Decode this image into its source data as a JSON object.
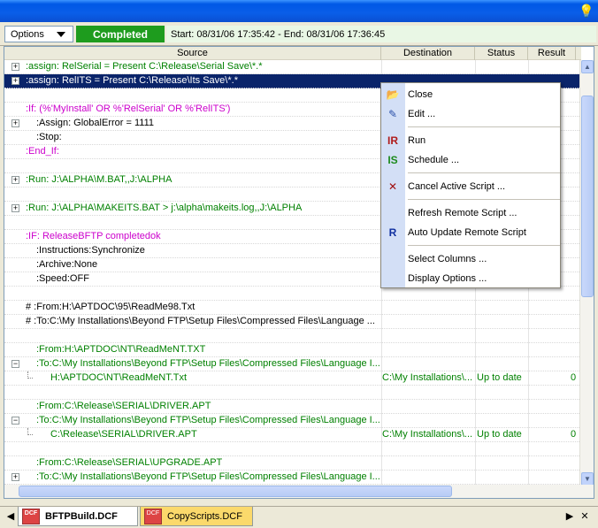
{
  "toolbar": {
    "options_label": "Options",
    "status": "Completed",
    "times": "Start: 08/31/06 17:35:42 - End: 08/31/06 17:36:45",
    "status_color": "#1e9c1e"
  },
  "columns": [
    "Source",
    "Destination",
    "Status",
    "Result"
  ],
  "rows": [
    {
      "src": ":assign: RelSerial = Present  C:\\Release\\Serial Save\\*.*",
      "color": "green",
      "exp": "+",
      "indent": 0
    },
    {
      "src": ":assign: RelITS    = Present  C:\\Release\\Its Save\\*.*",
      "color": "green",
      "exp": "+",
      "indent": 0,
      "selected": true
    },
    {
      "src": "",
      "indent": 0
    },
    {
      "src": ":If: (%'MyInstall' OR %'RelSerial' OR %'RelITS')",
      "color": "pink",
      "indent": 0
    },
    {
      "src": ":Assign: GlobalError = 1111",
      "color": "blk",
      "exp": "+",
      "indent": 1
    },
    {
      "src": ":Stop:",
      "color": "blk",
      "indent": 1
    },
    {
      "src": ":End_If:",
      "color": "pink",
      "indent": 0
    },
    {
      "src": "",
      "indent": 0
    },
    {
      "src": ":Run: J:\\ALPHA\\M.BAT,,J:\\ALPHA",
      "color": "green",
      "exp": "+",
      "indent": 0
    },
    {
      "src": "",
      "indent": 0
    },
    {
      "src": ":Run: J:\\ALPHA\\MAKEITS.BAT > j:\\alpha\\makeits.log,,J:\\ALPHA",
      "color": "green",
      "exp": "+",
      "indent": 0
    },
    {
      "src": "",
      "indent": 0
    },
    {
      "src": ":IF: ReleaseBFTP completedok",
      "color": "pink",
      "indent": 0
    },
    {
      "src": ":Instructions:Synchronize",
      "color": "blk",
      "indent": 1
    },
    {
      "src": ":Archive:None",
      "color": "blk",
      "indent": 1
    },
    {
      "src": ":Speed:OFF",
      "color": "blk",
      "indent": 1
    },
    {
      "src": "",
      "indent": 0
    },
    {
      "src": "#    :From:H:\\APTDOC\\95\\ReadMe98.Txt",
      "color": "blk",
      "indent": 0
    },
    {
      "src": "#    :To:C:\\My Installations\\Beyond FTP\\Setup Files\\Compressed Files\\Language ...",
      "color": "blk",
      "indent": 0
    },
    {
      "src": "",
      "indent": 0
    },
    {
      "src": ":From:H:\\APTDOC\\NT\\ReadMeNT.TXT",
      "color": "green",
      "indent": 1
    },
    {
      "src": ":To:C:\\My Installations\\Beyond FTP\\Setup Files\\Compressed Files\\Language I...",
      "color": "green",
      "exp": "-",
      "indent": 1
    },
    {
      "src": "H:\\APTDOC\\NT\\ReadMeNT.Txt",
      "color": "green",
      "indent": 2,
      "dst": "C:\\My Installations\\...",
      "sta": "Up to date",
      "res": "0"
    },
    {
      "src": "",
      "indent": 0
    },
    {
      "src": ":From:C:\\Release\\SERIAL\\DRIVER.APT",
      "color": "green",
      "indent": 1
    },
    {
      "src": ":To:C:\\My Installations\\Beyond FTP\\Setup Files\\Compressed Files\\Language I...",
      "color": "green",
      "exp": "-",
      "indent": 1
    },
    {
      "src": "C:\\Release\\SERIAL\\DRIVER.APT",
      "color": "green",
      "indent": 2,
      "dst": "C:\\My Installations\\...",
      "sta": "Up to date",
      "res": "0"
    },
    {
      "src": "",
      "indent": 0
    },
    {
      "src": ":From:C:\\Release\\SERIAL\\UPGRADE.APT",
      "color": "green",
      "indent": 1
    },
    {
      "src": ":To:C:\\My Installations\\Beyond FTP\\Setup Files\\Compressed Files\\Language I...",
      "color": "green",
      "exp": "+",
      "indent": 1
    }
  ],
  "menu": [
    {
      "label": "Close",
      "icon": "folder-open-icon",
      "glyph": "📂"
    },
    {
      "label": "Edit ...",
      "icon": "edit-icon",
      "glyph": "✎"
    },
    {
      "sep": true
    },
    {
      "label": "Run",
      "icon": "run-icon",
      "glyph": "IR"
    },
    {
      "label": "Schedule ...",
      "icon": "schedule-icon",
      "glyph": "IS"
    },
    {
      "sep": true
    },
    {
      "label": "Cancel Active Script ...",
      "icon": "cancel-icon",
      "glyph": "✕"
    },
    {
      "sep": true
    },
    {
      "label": "Refresh Remote Script ...",
      "icon": "refresh-icon",
      "glyph": ""
    },
    {
      "label": "Auto Update Remote Script",
      "icon": "auto-update-icon",
      "glyph": "R"
    },
    {
      "sep": true
    },
    {
      "label": "Select Columns ...",
      "icon": "columns-icon",
      "glyph": ""
    },
    {
      "label": "Display Options ...",
      "icon": "display-options-icon",
      "glyph": ""
    }
  ],
  "tabs": [
    {
      "label": "BFTPBuild.DCF",
      "active": true,
      "icon_text": "DCF"
    },
    {
      "label": "CopyScripts.DCF",
      "active": false,
      "icon_text": "DCF"
    }
  ],
  "colors": {
    "green": "#008000",
    "pink": "#cc00cc",
    "selection": "#0a246a"
  }
}
